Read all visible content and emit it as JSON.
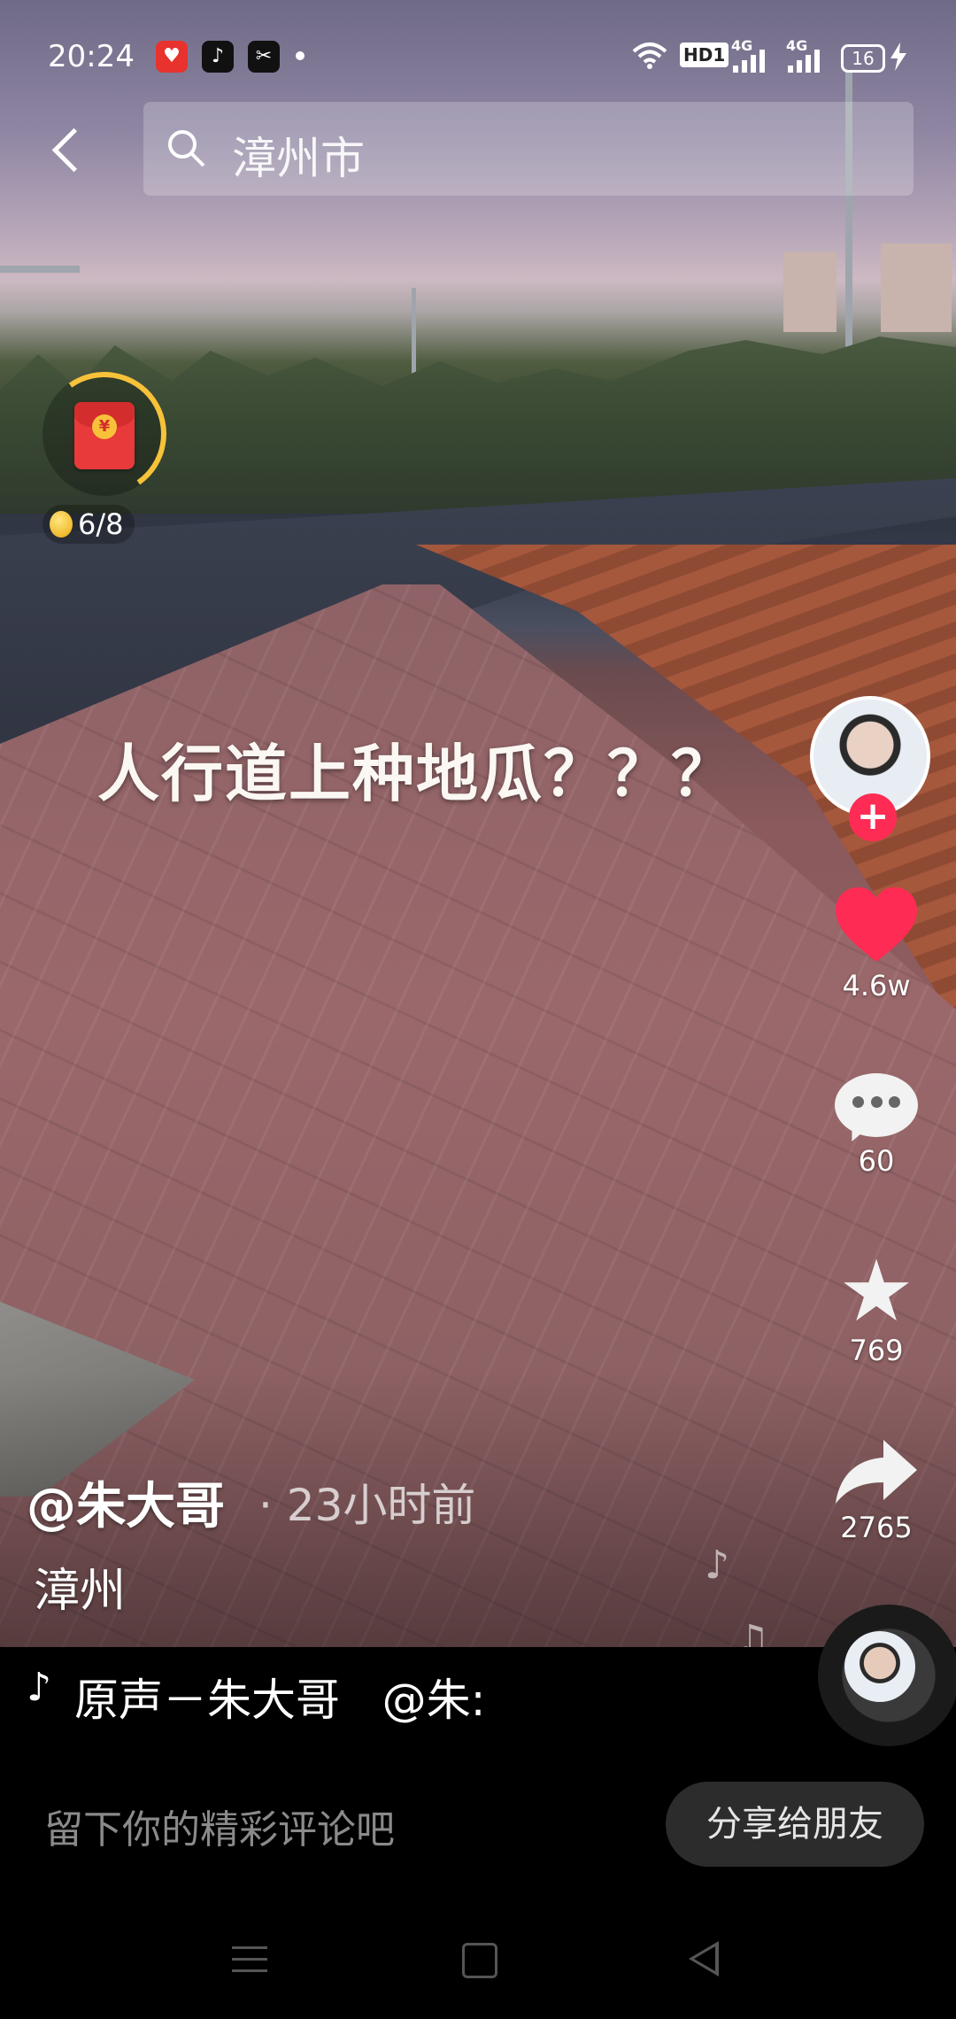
{
  "status_bar": {
    "time": "20:24",
    "apps": [
      "heart-app-icon",
      "tiktok-icon",
      "capcut-icon"
    ],
    "hd_label": "HD1",
    "net1": "4G",
    "net2": "4G",
    "battery": "16"
  },
  "header": {
    "search_text": "漳州市"
  },
  "red_packet": {
    "progress": "6/8",
    "seal": "¥"
  },
  "video": {
    "overlay_caption": "人行道上种地瓜？？？"
  },
  "actions": {
    "likes": "4.6w",
    "comments": "60",
    "favorites": "769",
    "shares": "2765"
  },
  "author": {
    "name": "@朱大哥",
    "time_ago": "· 23小时前",
    "description": "漳州"
  },
  "music": {
    "text": "原声－朱大哥   @朱:"
  },
  "comment_bar": {
    "placeholder": "留下你的精彩评论吧",
    "share_label": "分享给朋友"
  },
  "colors": {
    "like_red": "#fe2c55",
    "packet_red": "#e83a3a",
    "ring_gold": "#f7c23a"
  }
}
